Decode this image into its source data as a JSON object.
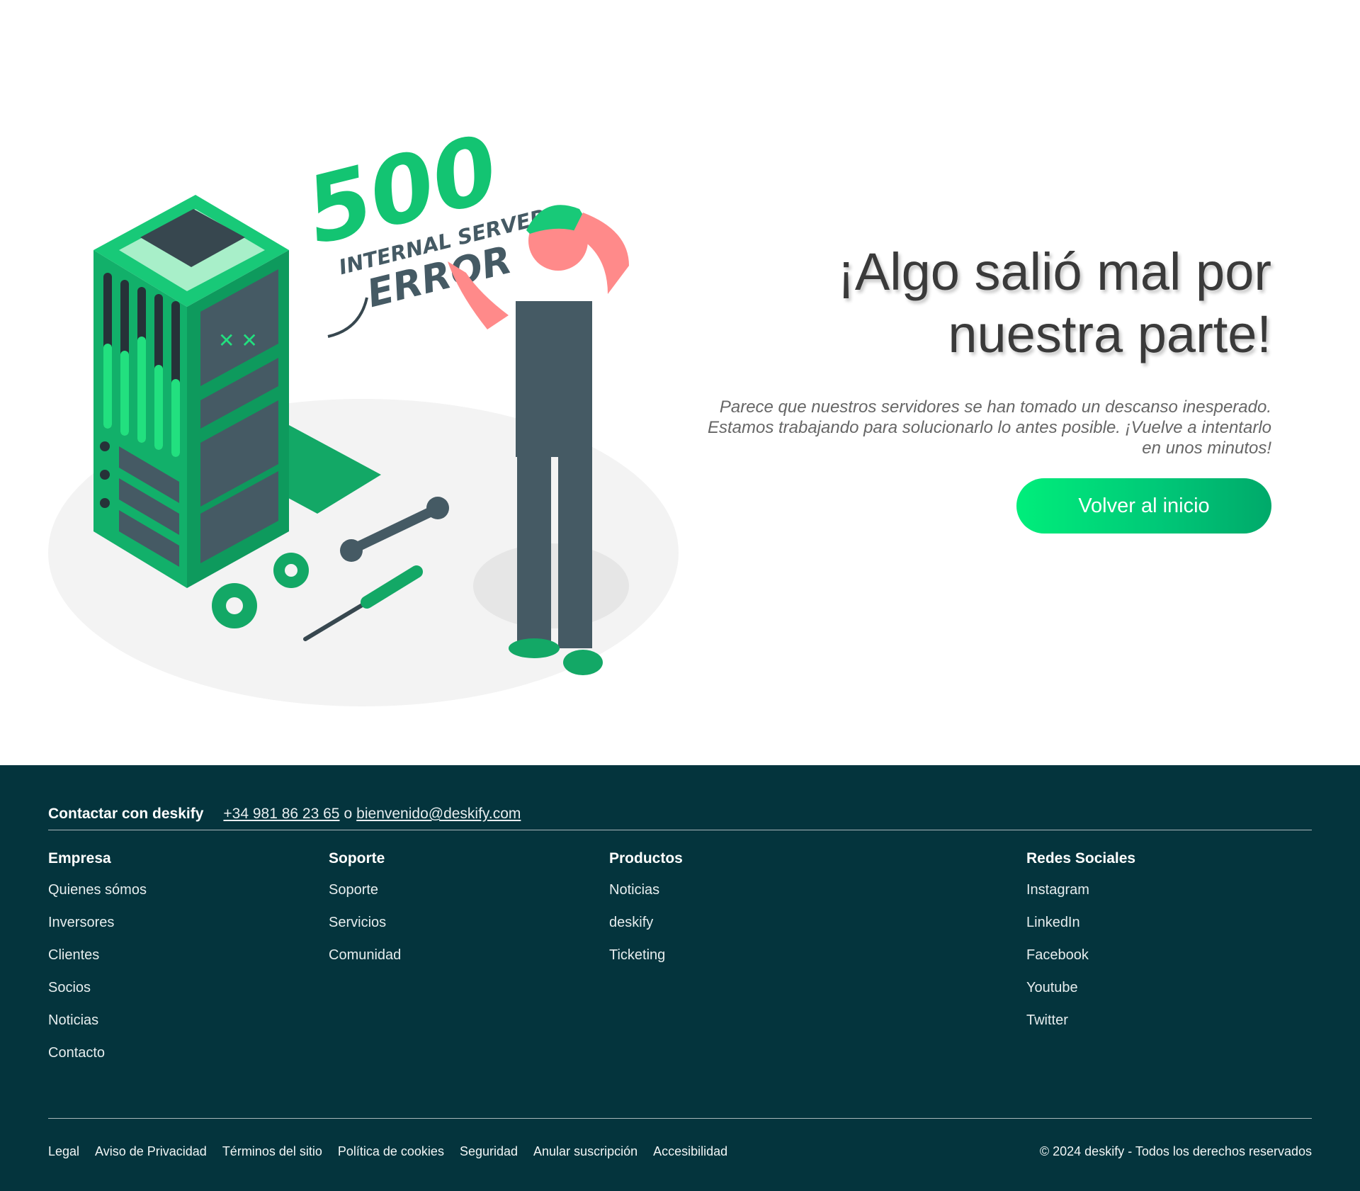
{
  "hero": {
    "illustration": {
      "code": "500",
      "line1": "INTERNAL SERVER",
      "line2": "ERROR"
    },
    "title_line1": "¡Algo salió mal por",
    "title_line2": "nuestra parte!",
    "description": "Parece que nuestros servidores se han tomado un descanso inesperado. Estamos trabajando para solucionarlo lo antes posible. ¡Vuelve a intentarlo en unos minutos!",
    "button_label": "Volver al inicio"
  },
  "colors": {
    "brand_green": "#00c978",
    "footer_bg": "#04343d",
    "illustration_green": "#13b46c",
    "illustration_dark": "#455a64"
  },
  "footer": {
    "contact": {
      "title": "Contactar con deskify",
      "phone": "+34 981 86 23 65",
      "or": "o",
      "email": "bienvenido@deskify.com"
    },
    "columns": [
      {
        "title": "Empresa",
        "links": [
          "Quienes sómos",
          "Inversores",
          "Clientes",
          "Socios",
          "Noticias",
          "Contacto"
        ]
      },
      {
        "title": "Soporte",
        "links": [
          "Soporte",
          "Servicios",
          "Comunidad"
        ]
      },
      {
        "title": "Productos",
        "links": [
          "Noticias",
          "deskify",
          "Ticketing"
        ]
      },
      {
        "title": "Redes Sociales",
        "links": [
          "Instagram",
          "LinkedIn",
          "Facebook",
          "Youtube",
          "Twitter"
        ]
      }
    ],
    "legal_links": [
      "Legal",
      "Aviso de Privacidad",
      "Términos del sitio",
      "Política de cookies",
      "Seguridad",
      "Anular suscripción",
      "Accesibilidad"
    ],
    "copyright": "© 2024 deskify - Todos los derechos reservados"
  }
}
